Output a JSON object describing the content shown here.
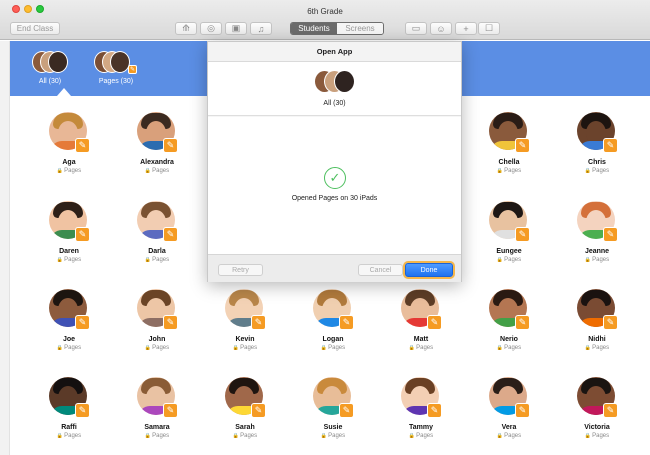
{
  "window": {
    "title": "6th Grade"
  },
  "toolbar": {
    "end_class_label": "End Class",
    "segments": {
      "students_label": "Students",
      "screens_label": "Screens",
      "selected": "Students"
    },
    "icons": [
      "navigate-icon",
      "safari-compass-icon",
      "lock-icon",
      "mute-icon",
      "airplay-icon",
      "person-icon",
      "add-icon",
      "group-icon"
    ]
  },
  "groups": [
    {
      "label": "All (30)",
      "selected": true
    },
    {
      "label": "Pages (30)",
      "selected": false
    }
  ],
  "dialog": {
    "title": "Open App",
    "group_label": "All (30)",
    "status_message": "Opened Pages on 30 iPads",
    "retry_label": "Retry",
    "cancel_label": "Cancel",
    "done_label": "Done"
  },
  "students": [
    {
      "name": "Aga",
      "app": "Pages"
    },
    {
      "name": "Alexandra",
      "app": "Pages"
    },
    {
      "name": "Chella",
      "app": "Pages"
    },
    {
      "name": "Chris",
      "app": "Pages"
    },
    {
      "name": "Daren",
      "app": "Pages"
    },
    {
      "name": "Darla",
      "app": "Pages"
    },
    {
      "name": "Eungee",
      "app": "Pages"
    },
    {
      "name": "Jeanne",
      "app": "Pages"
    },
    {
      "name": "Joe",
      "app": "Pages"
    },
    {
      "name": "John",
      "app": "Pages"
    },
    {
      "name": "Kevin",
      "app": "Pages"
    },
    {
      "name": "Logan",
      "app": "Pages"
    },
    {
      "name": "Matt",
      "app": "Pages"
    },
    {
      "name": "Nerio",
      "app": "Pages"
    },
    {
      "name": "Nidhi",
      "app": "Pages"
    },
    {
      "name": "Raffi",
      "app": "Pages"
    },
    {
      "name": "Samara",
      "app": "Pages"
    },
    {
      "name": "Sarah",
      "app": "Pages"
    },
    {
      "name": "Susie",
      "app": "Pages"
    },
    {
      "name": "Tammy",
      "app": "Pages"
    },
    {
      "name": "Vera",
      "app": "Pages"
    },
    {
      "name": "Victoria",
      "app": "Pages"
    }
  ],
  "colors": {
    "band": "#5b8ee4",
    "pages_badge": "#f59b23",
    "done_button": "#1f72f0",
    "success": "#4cbf5e"
  }
}
